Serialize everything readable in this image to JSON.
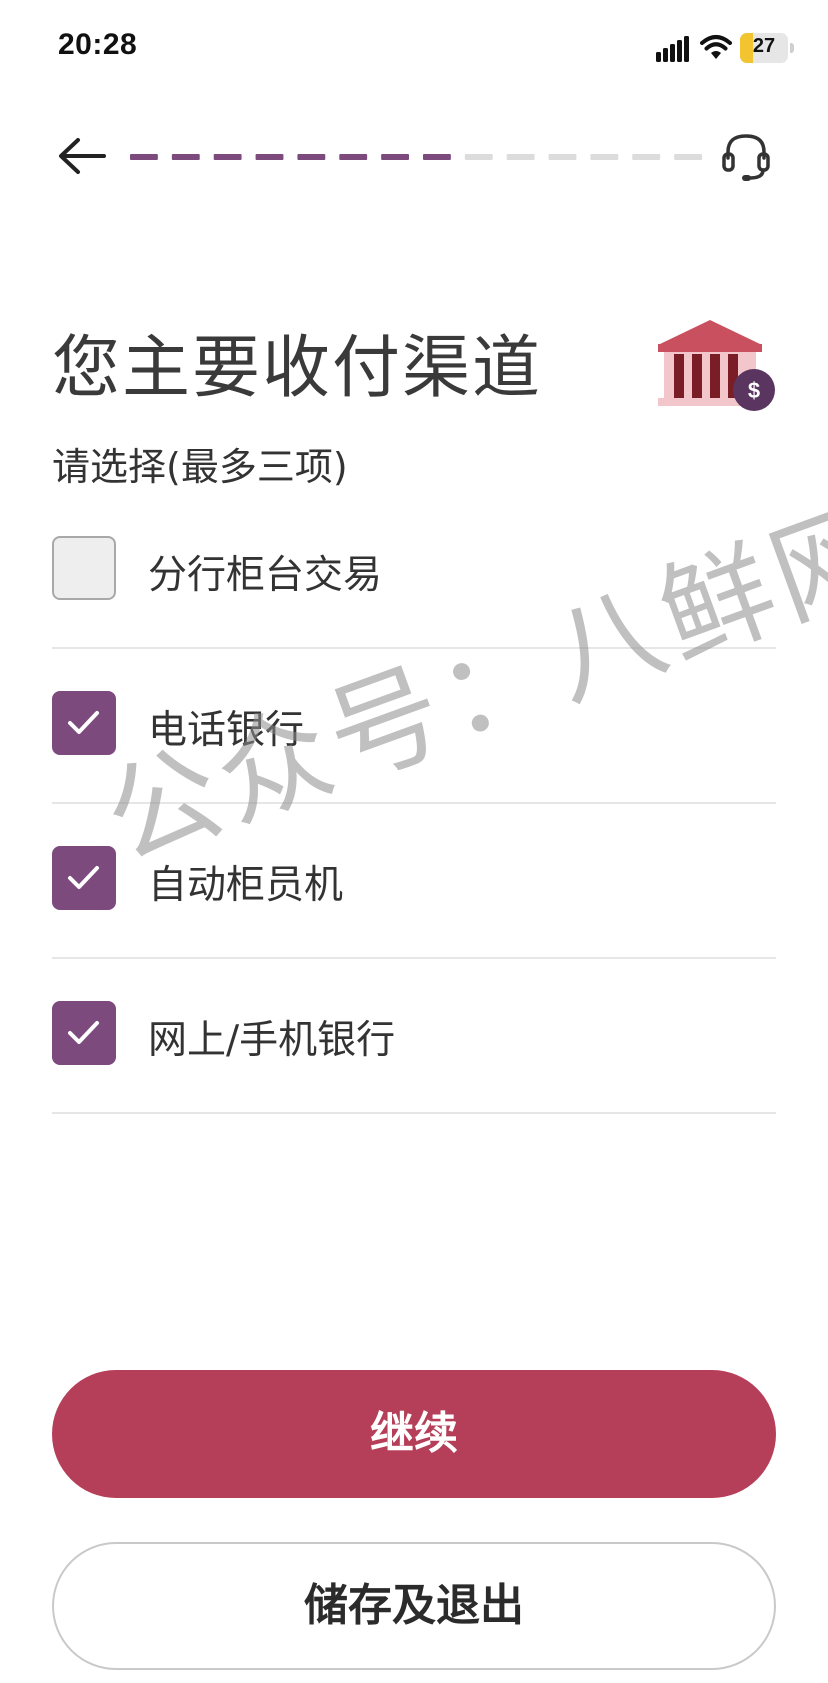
{
  "status_bar": {
    "time": "20:28",
    "battery_level": "27",
    "battery_fraction": 0.27,
    "icons": [
      "signal-icon",
      "wifi-icon",
      "battery-icon"
    ]
  },
  "header": {
    "back_icon": "arrow-left-icon",
    "support_icon": "headset-icon",
    "progress": {
      "completed_steps": 8,
      "total_steps": 14
    },
    "colors": {
      "progress_done": "#7d4a7e",
      "progress_todo": "#dcdcdc"
    }
  },
  "main": {
    "title": "您主要收付渠道",
    "subtitle": "请选择(最多三项)",
    "illustration": "bank-building-dollar-icon",
    "options": [
      {
        "label": "分行柜台交易",
        "checked": false
      },
      {
        "label": "电话银行",
        "checked": true
      },
      {
        "label": "自动柜员机",
        "checked": true
      },
      {
        "label": "网上/手机银行",
        "checked": true
      }
    ]
  },
  "watermark": "公众号：八鲜网",
  "footer": {
    "continue_label": "继续",
    "save_exit_label": "储存及退出"
  },
  "colors": {
    "accent": "#b53f58",
    "checkbox_checked": "#7d4a7e",
    "divider": "#e6e6e6"
  }
}
